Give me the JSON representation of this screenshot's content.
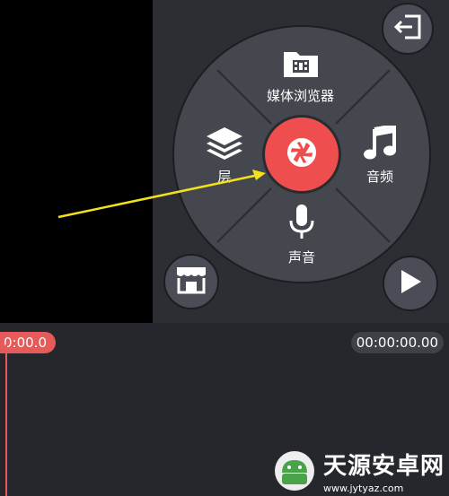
{
  "menu": {
    "media_browser_label": "媒体浏览器",
    "layer_label": "层",
    "audio_label": "音频",
    "voice_label": "声音"
  },
  "timeline": {
    "current_time": "0:00.0",
    "total_time": "00:00:00.00"
  },
  "watermark": {
    "site_name": "天源安卓网",
    "site_url": "www.jytyaz.com"
  },
  "colors": {
    "record_button": "#ef4e4e",
    "playhead": "#e65a5a",
    "annotation_arrow": "#f2e21a"
  }
}
